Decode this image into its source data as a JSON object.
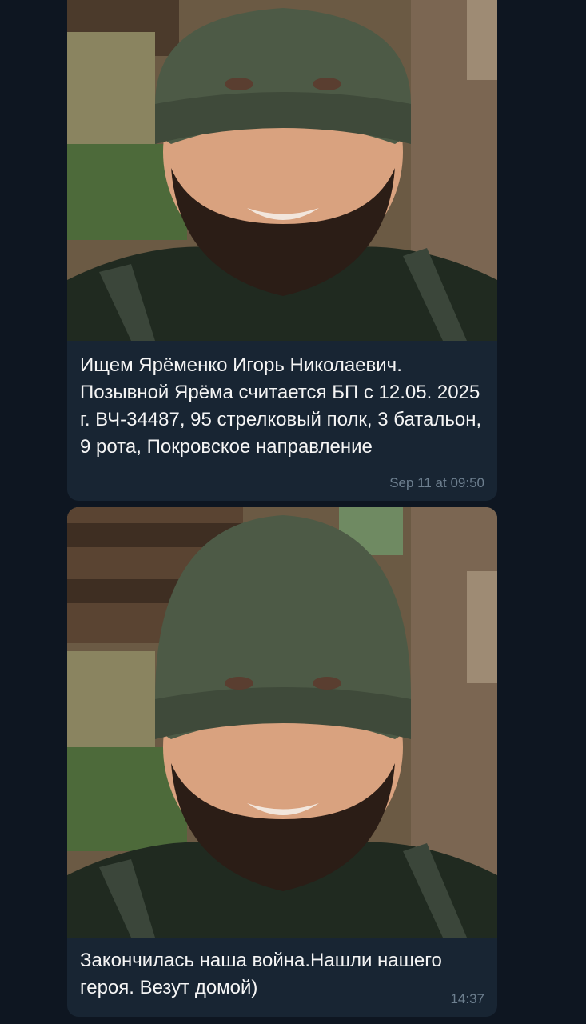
{
  "messages": [
    {
      "caption": "Ищем Ярёменко Игорь Николаевич. Позывной Ярёма считается БП с 12.05. 2025 г. ВЧ-34487, 95 стрелковый полк, 3 батальон, 9 рота, Покровское направление",
      "time": "Sep 11 at 09:50"
    },
    {
      "caption": "Закончилась наша война.Нашли нашего героя. Везут домой)",
      "time": "14:37"
    }
  ],
  "colors": {
    "background": "#0e1621",
    "bubble": "#182533",
    "text": "#f5f5f5",
    "time": "#6d7f8f"
  }
}
